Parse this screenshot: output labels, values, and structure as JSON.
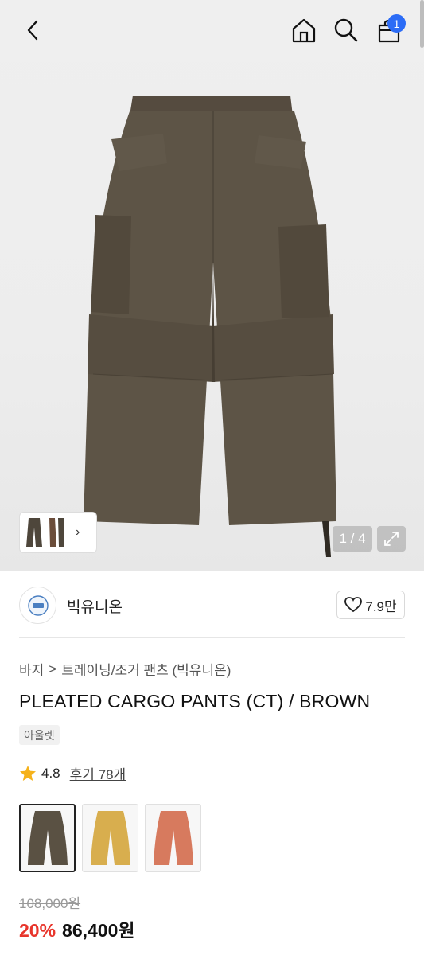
{
  "header": {
    "cart_count": "1"
  },
  "gallery": {
    "counter": "1 / 4",
    "thumb_arrow": "›"
  },
  "brand": {
    "name": "빅유니온",
    "likes": "7.9만"
  },
  "breadcrumb": {
    "items": [
      "바지",
      "트레이닝/조거 팬츠 (빅유니온)"
    ],
    "separator": ">"
  },
  "product": {
    "title": "PLEATED CARGO PANTS (CT) / BROWN",
    "tag": "아울렛",
    "rating": "4.8",
    "reviews_label": "후기 78개",
    "original_price": "108,000원",
    "discount": "20%",
    "price": "86,400원"
  },
  "colors": {
    "swatches": [
      {
        "color": "#5a5143",
        "selected": true
      },
      {
        "color": "#d8ae4e",
        "selected": false
      },
      {
        "color": "#d77a5e",
        "selected": false
      }
    ]
  },
  "theme": {
    "accent_red": "#e8352b",
    "badge_blue": "#2c6cf6",
    "star": "#f5b21b",
    "pants": "#5a5143"
  }
}
